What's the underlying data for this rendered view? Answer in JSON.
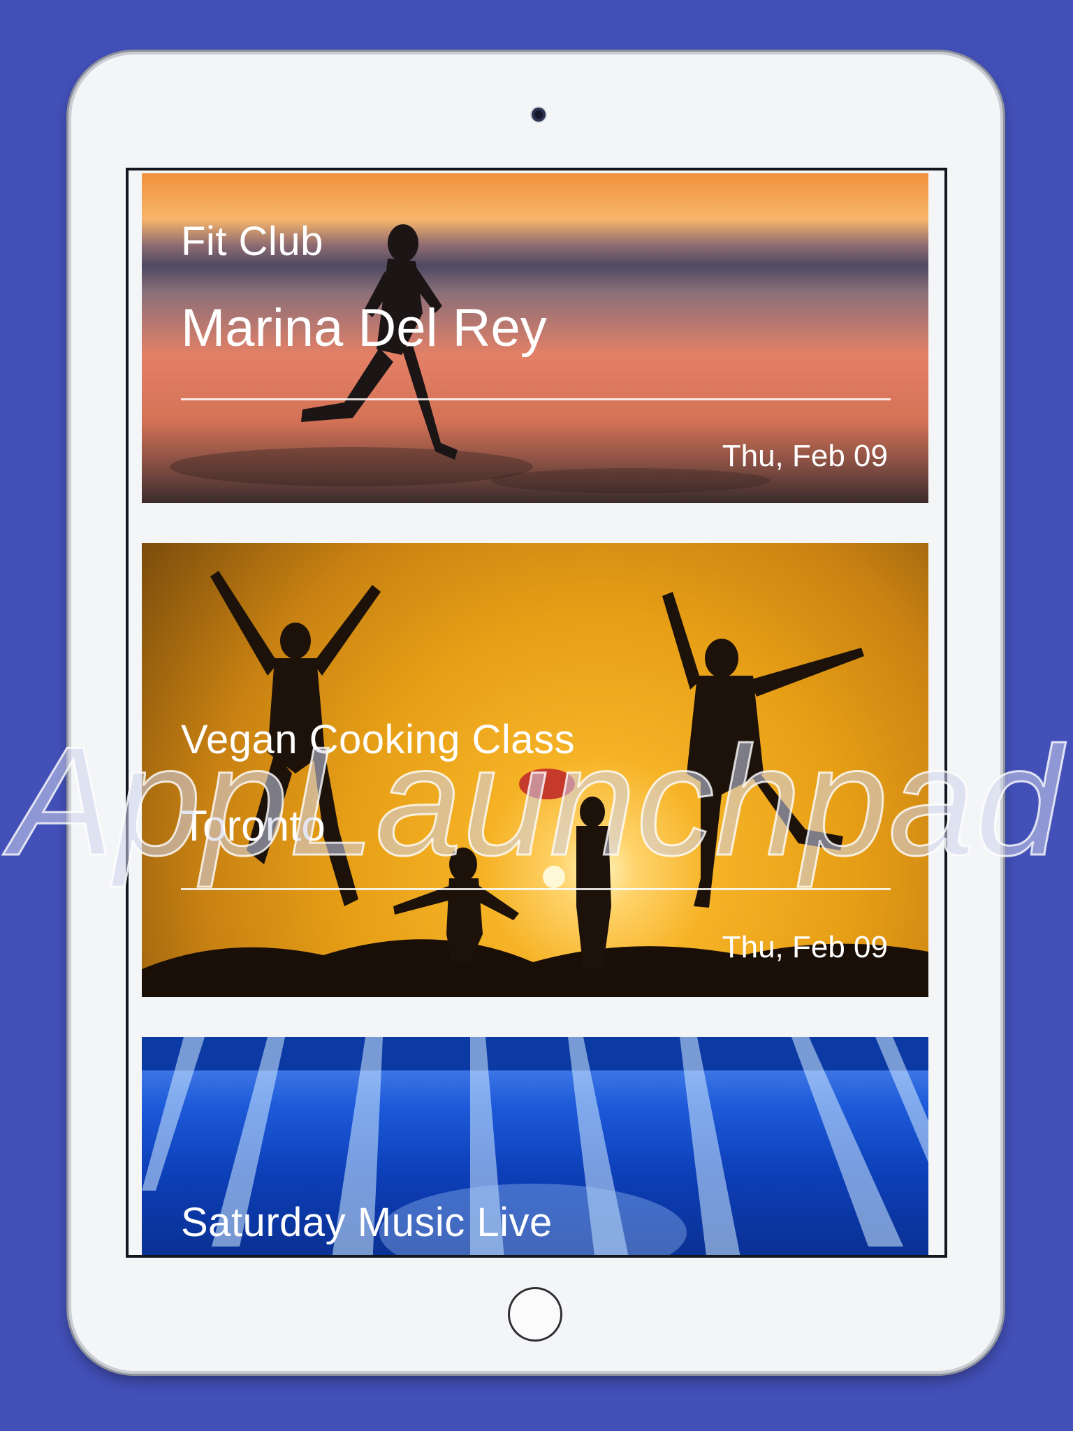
{
  "cards": [
    {
      "title": "Fit Club",
      "location": "Marina Del Rey",
      "date": "Thu, Feb 09"
    },
    {
      "title": "Vegan Cooking Class",
      "location": "Toronto",
      "date": "Thu, Feb 09"
    },
    {
      "title": "Saturday Music Live"
    }
  ],
  "watermark": "AppLaunchpad",
  "colors": {
    "background": "#4350b8",
    "device": "#f4f5f7"
  }
}
